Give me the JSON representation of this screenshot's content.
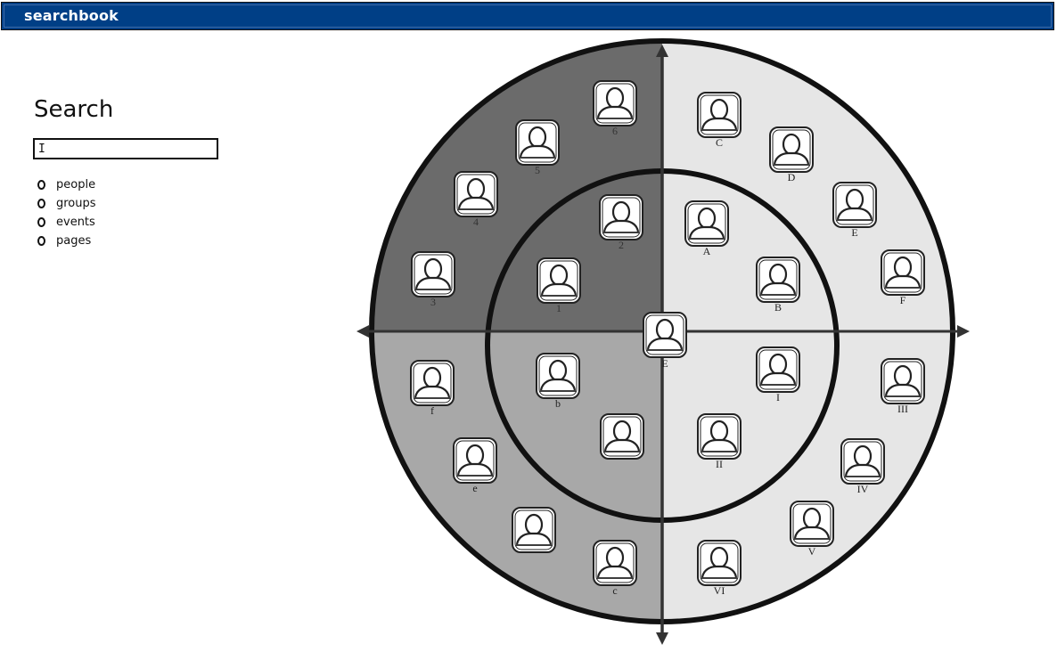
{
  "app": {
    "title": "searchbook"
  },
  "search": {
    "heading": "Search",
    "value": "I",
    "options": [
      {
        "label": "people"
      },
      {
        "label": "groups"
      },
      {
        "label": "events"
      },
      {
        "label": "pages"
      }
    ]
  },
  "radar": {
    "center_label": "E",
    "quadrant_colors": {
      "top_left": "#6b6b6b",
      "top_right": "#e6e6e6",
      "bottom_left": "#a8a8a8",
      "bottom_right": "#e6e6e6"
    },
    "people": [
      {
        "label": "6",
        "quadrant": "top-left"
      },
      {
        "label": "5",
        "quadrant": "top-left"
      },
      {
        "label": "4",
        "quadrant": "top-left"
      },
      {
        "label": "3",
        "quadrant": "top-left"
      },
      {
        "label": "2",
        "quadrant": "top-left"
      },
      {
        "label": "1",
        "quadrant": "top-left"
      },
      {
        "label": "C",
        "quadrant": "top-right"
      },
      {
        "label": "D",
        "quadrant": "top-right"
      },
      {
        "label": "E",
        "quadrant": "top-right"
      },
      {
        "label": "F",
        "quadrant": "top-right"
      },
      {
        "label": "A",
        "quadrant": "top-right"
      },
      {
        "label": "B",
        "quadrant": "top-right"
      },
      {
        "label": "f",
        "quadrant": "bottom-left"
      },
      {
        "label": "b",
        "quadrant": "bottom-left"
      },
      {
        "label": "",
        "quadrant": "bottom-left"
      },
      {
        "label": "e",
        "quadrant": "bottom-left"
      },
      {
        "label": "",
        "quadrant": "bottom-left"
      },
      {
        "label": "c",
        "quadrant": "bottom-left"
      },
      {
        "label": "I",
        "quadrant": "bottom-right"
      },
      {
        "label": "III",
        "quadrant": "bottom-right"
      },
      {
        "label": "II",
        "quadrant": "bottom-right"
      },
      {
        "label": "IV",
        "quadrant": "bottom-right"
      },
      {
        "label": "V",
        "quadrant": "bottom-right"
      },
      {
        "label": "VI",
        "quadrant": "bottom-right"
      }
    ]
  }
}
